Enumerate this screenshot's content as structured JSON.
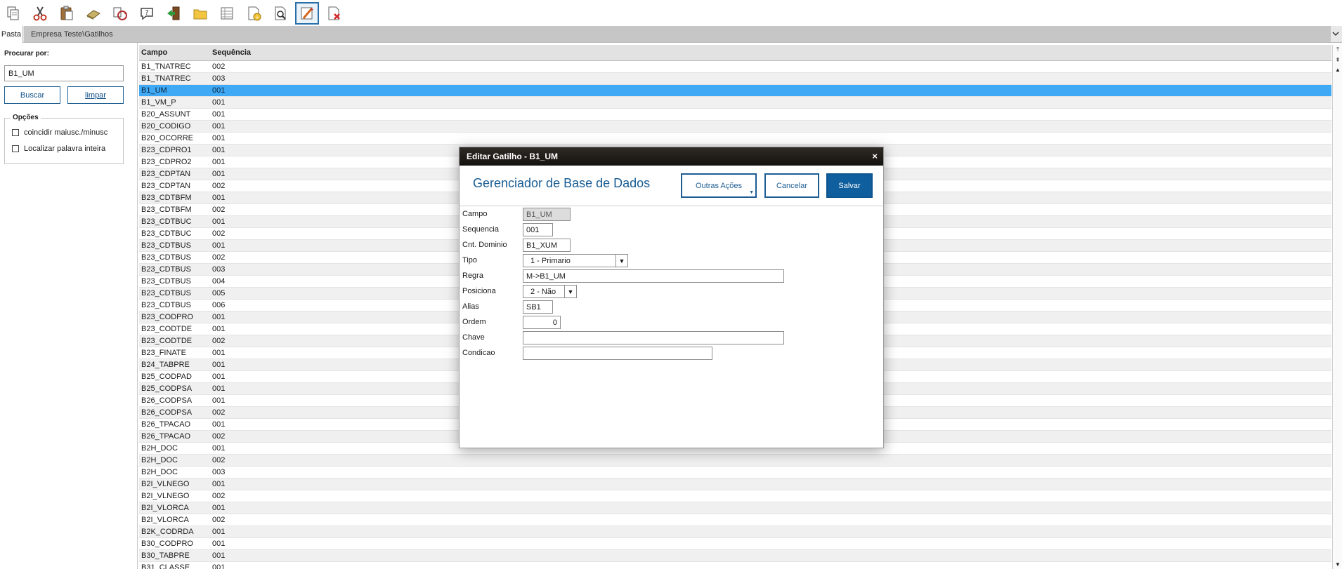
{
  "toolbar": {
    "icons": [
      "copy-icon",
      "cut-icon",
      "paste-icon",
      "eraser-icon",
      "sync-icon",
      "help-icon",
      "exit-icon",
      "folder-icon",
      "table-icon",
      "add-page-icon",
      "preview-icon",
      "edit-trigger-icon",
      "delete-icon"
    ],
    "active_index": 11
  },
  "tabs": {
    "pasta": "Pasta",
    "path": "Empresa Teste\\Gatilhos"
  },
  "search": {
    "label": "Procurar por:",
    "value": "B1_UM",
    "buscar": "Buscar",
    "limpar": "limpar",
    "opcoes_title": "Opções",
    "opt_case": "coincidir maiusc./minusc",
    "opt_whole": "Localizar palavra inteira"
  },
  "grid": {
    "col_campo": "Campo",
    "col_seq": "Sequência",
    "selected_index": 2,
    "rows": [
      [
        "B1_TNATREC",
        "002"
      ],
      [
        "B1_TNATREC",
        "003"
      ],
      [
        "B1_UM",
        "001"
      ],
      [
        "B1_VM_P",
        "001"
      ],
      [
        "B20_ASSUNT",
        "001"
      ],
      [
        "B20_CODIGO",
        "001"
      ],
      [
        "B20_OCORRE",
        "001"
      ],
      [
        "B23_CDPRO1",
        "001"
      ],
      [
        "B23_CDPRO2",
        "001"
      ],
      [
        "B23_CDPTAN",
        "001"
      ],
      [
        "B23_CDPTAN",
        "002"
      ],
      [
        "B23_CDTBFM",
        "001"
      ],
      [
        "B23_CDTBFM",
        "002"
      ],
      [
        "B23_CDTBUC",
        "001"
      ],
      [
        "B23_CDTBUC",
        "002"
      ],
      [
        "B23_CDTBUS",
        "001"
      ],
      [
        "B23_CDTBUS",
        "002"
      ],
      [
        "B23_CDTBUS",
        "003"
      ],
      [
        "B23_CDTBUS",
        "004"
      ],
      [
        "B23_CDTBUS",
        "005"
      ],
      [
        "B23_CDTBUS",
        "006"
      ],
      [
        "B23_CODPRO",
        "001"
      ],
      [
        "B23_CODTDE",
        "001"
      ],
      [
        "B23_CODTDE",
        "002"
      ],
      [
        "B23_FINATE",
        "001"
      ],
      [
        "B24_TABPRE",
        "001"
      ],
      [
        "B25_CODPAD",
        "001"
      ],
      [
        "B25_CODPSA",
        "001"
      ],
      [
        "B26_CODPSA",
        "001"
      ],
      [
        "B26_CODPSA",
        "002"
      ],
      [
        "B26_TPACAO",
        "001"
      ],
      [
        "B26_TPACAO",
        "002"
      ],
      [
        "B2H_DOC",
        "001"
      ],
      [
        "B2H_DOC",
        "002"
      ],
      [
        "B2H_DOC",
        "003"
      ],
      [
        "B2I_VLNEGO",
        "001"
      ],
      [
        "B2I_VLNEGO",
        "002"
      ],
      [
        "B2I_VLORCA",
        "001"
      ],
      [
        "B2I_VLORCA",
        "002"
      ],
      [
        "B2K_CODRDA",
        "001"
      ],
      [
        "B30_CODPRO",
        "001"
      ],
      [
        "B30_TABPRE",
        "001"
      ],
      [
        "B31_CLASSE",
        "001"
      ]
    ]
  },
  "modal": {
    "title": "Editar Gatilho - B1_UM",
    "close": "×",
    "heading": "Gerenciador de Base de Dados",
    "btn_outras": "Outras Ações",
    "btn_cancelar": "Cancelar",
    "btn_salvar": "Salvar",
    "fields": {
      "campo_label": "Campo",
      "campo_value": "B1_UM",
      "sequencia_label": "Sequencia",
      "sequencia_value": "001",
      "dominio_label": "Cnt. Dominio",
      "dominio_value": "B1_XUM",
      "tipo_label": "Tipo",
      "tipo_value": "1 - Primario",
      "regra_label": "Regra",
      "regra_value": "M->B1_UM",
      "posiciona_label": "Posiciona",
      "posiciona_value": "2 - Não",
      "alias_label": "Alias",
      "alias_value": "SB1",
      "ordem_label": "Ordem",
      "ordem_value": "0",
      "chave_label": "Chave",
      "chave_value": "",
      "condicao_label": "Condicao",
      "condicao_value": ""
    }
  }
}
